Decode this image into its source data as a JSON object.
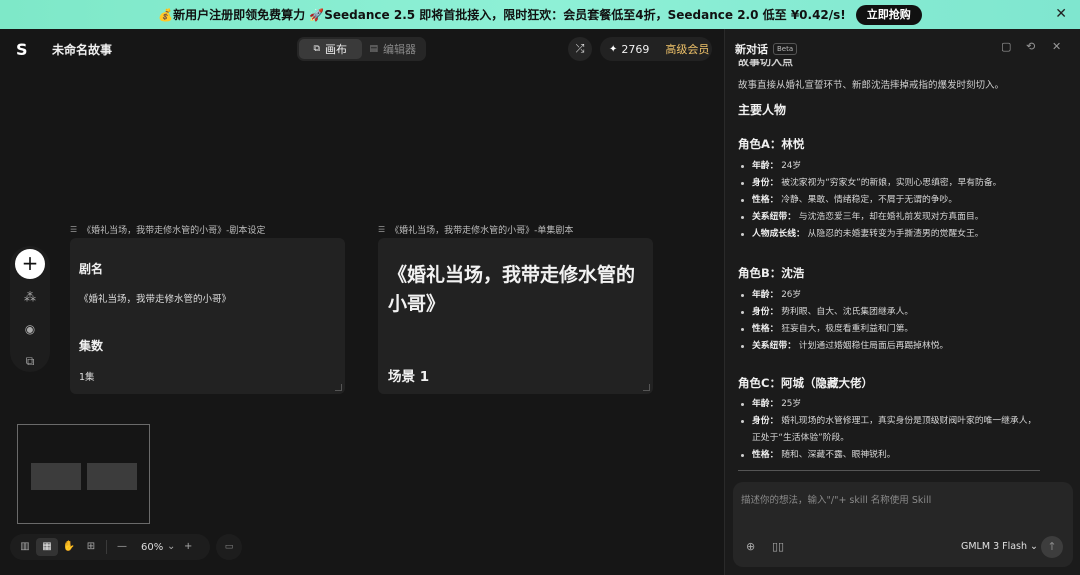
{
  "banner": {
    "text": "💰新用户注册即领免费算力 🚀Seedance 2.5 即将首批接入，限时狂欢：会员套餐低至4折，Seedance 2.0 低至 ¥0.42/s!",
    "button": "立即抢购",
    "close": "✕"
  },
  "header": {
    "logo": "S",
    "title": "未命名故事",
    "modes": [
      {
        "icon": "⧉",
        "label": "画布"
      },
      {
        "icon": "▤",
        "label": "编辑器"
      }
    ],
    "share_icon": "⤮",
    "credits": "2769",
    "diamond": "✦",
    "vip": "高级会员"
  },
  "tools": {
    "plus": "+",
    "items": [
      "⁂",
      "◉",
      "⧉"
    ]
  },
  "cards": {
    "setting": {
      "label": "《婚礼当场，我带走修水管的小哥》-剧本设定",
      "h1": "剧名",
      "v1": "《婚礼当场，我带走修水管的小哥》",
      "h2": "集数",
      "v2": "1集"
    },
    "episode": {
      "label": "《婚礼当场，我带走修水管的小哥》-单集剧本",
      "title": "《婚礼当场，我带走修水管的小哥》",
      "scene": "场景 1"
    }
  },
  "bottombar": {
    "icons": [
      "▥",
      "▦",
      "✋",
      "⊞"
    ],
    "minus": "—",
    "zoom": "60%",
    "chevron": "⌄",
    "plus": "+",
    "extra": "▭"
  },
  "panel": {
    "title": "新对话",
    "beta": "Beta",
    "icons": [
      "▢",
      "⟲",
      "✕"
    ],
    "cut_heading": "故事切入点",
    "intro": "故事直接从婚礼宣誓环节、新郎沈浩摔掉戒指的爆发时刻切入。",
    "section": "主要人物",
    "roles": [
      {
        "name": "角色A：林悦",
        "items": [
          {
            "k": "年龄：",
            "v": "24岁"
          },
          {
            "k": "身份：",
            "v": "被沈家视为“穷家女”的新娘，实则心思缜密，早有防备。"
          },
          {
            "k": "性格：",
            "v": "冷静、果敢、情绪稳定，不屑于无谓的争吵。"
          },
          {
            "k": "关系纽带：",
            "v": "与沈浩恋爱三年，却在婚礼前发现对方真面目。"
          },
          {
            "k": "人物成长线：",
            "v": "从隐忍的未婚妻转变为手撕渣男的觉醒女王。"
          }
        ]
      },
      {
        "name": "角色B：沈浩",
        "items": [
          {
            "k": "年龄：",
            "v": "26岁"
          },
          {
            "k": "身份：",
            "v": "势利眼、自大、沈氏集团继承人。"
          },
          {
            "k": "性格：",
            "v": "狂妄自大，极度看重利益和门第。"
          },
          {
            "k": "关系纽带：",
            "v": "计划通过婚姻稳住局面后再踢掉林悦。"
          }
        ]
      },
      {
        "name": "角色C：阿城（隐藏大佬）",
        "items": [
          {
            "k": "年龄：",
            "v": "25岁"
          },
          {
            "k": "身份：",
            "v": "婚礼现场的水管修理工，真实身份是顶级财阀叶家的唯一继承人，正处于“生活体验”阶段。"
          },
          {
            "k": "性格：",
            "v": "随和、深藏不露、眼神锐利。"
          }
        ]
      }
    ],
    "input_placeholder": "描述你的想法，输入\"/\"+ skill 名称使用 Skill",
    "input_icons": [
      "⊕",
      "▯▯"
    ],
    "model": "GMLM 3 Flash ⌄",
    "send": "↑"
  }
}
